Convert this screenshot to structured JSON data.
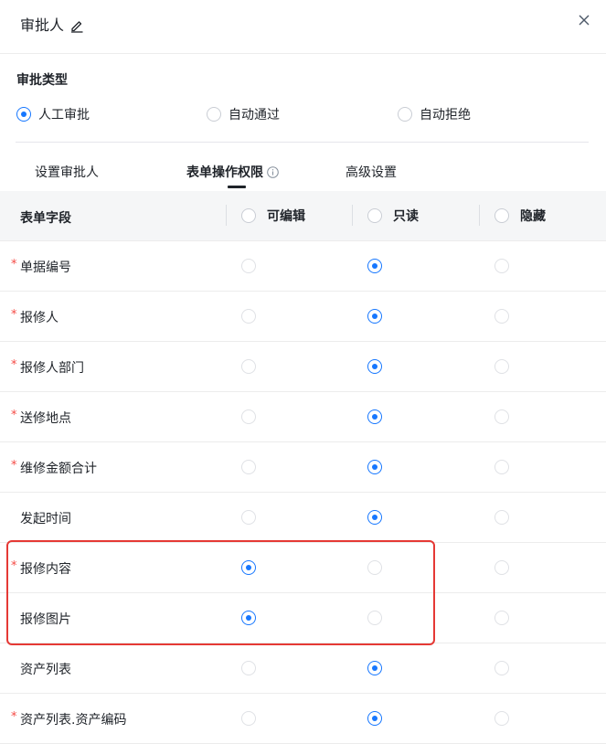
{
  "header": {
    "title": "审批人"
  },
  "approval_type": {
    "label": "审批类型",
    "options": [
      {
        "label": "人工审批",
        "selected": true
      },
      {
        "label": "自动通过",
        "selected": false
      },
      {
        "label": "自动拒绝",
        "selected": false
      }
    ]
  },
  "tabs": [
    {
      "label": "设置审批人",
      "active": false
    },
    {
      "label": "表单操作权限",
      "active": true
    },
    {
      "label": "高级设置",
      "active": false
    }
  ],
  "table": {
    "headers": {
      "field": "表单字段",
      "editable": "可编辑",
      "readonly": "只读",
      "hidden": "隐藏"
    },
    "rows": [
      {
        "name": "单据编号",
        "required": true,
        "value": "readonly"
      },
      {
        "name": "报修人",
        "required": true,
        "value": "readonly"
      },
      {
        "name": "报修人部门",
        "required": true,
        "value": "readonly"
      },
      {
        "name": "送修地点",
        "required": true,
        "value": "readonly"
      },
      {
        "name": "维修金额合计",
        "required": true,
        "value": "readonly"
      },
      {
        "name": "发起时间",
        "required": false,
        "value": "readonly"
      },
      {
        "name": "报修内容",
        "required": true,
        "value": "editable"
      },
      {
        "name": "报修图片",
        "required": false,
        "value": "editable"
      },
      {
        "name": "资产列表",
        "required": false,
        "value": "readonly"
      },
      {
        "name": "资产列表.资产编码",
        "required": true,
        "value": "readonly"
      }
    ],
    "required_mark": "*"
  },
  "colors": {
    "accent": "#1677ff",
    "required": "#f54a45",
    "highlight": "#e53935"
  }
}
